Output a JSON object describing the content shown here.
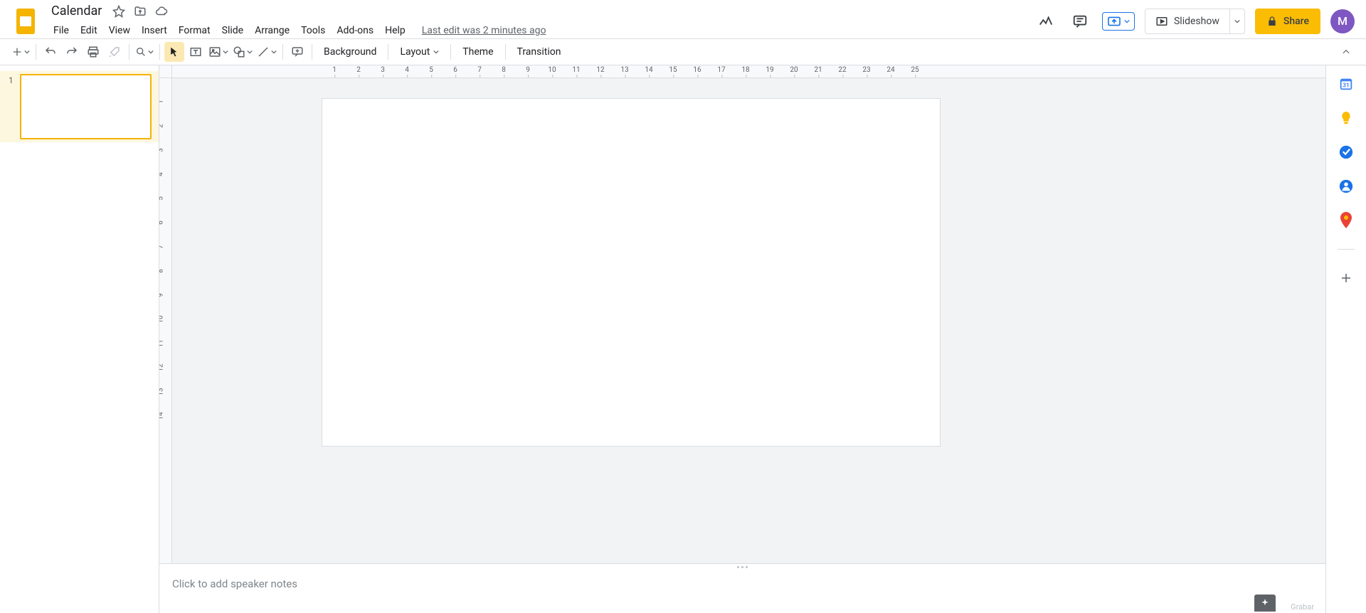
{
  "document": {
    "title": "Calendar",
    "last_edit": "Last edit was 2 minutes ago"
  },
  "menus": [
    "File",
    "Edit",
    "View",
    "Insert",
    "Format",
    "Slide",
    "Arrange",
    "Tools",
    "Add-ons",
    "Help"
  ],
  "header_buttons": {
    "slideshow": "Slideshow",
    "share": "Share"
  },
  "avatar": "M",
  "toolbar_text": {
    "background": "Background",
    "layout": "Layout",
    "theme": "Theme",
    "transition": "Transition"
  },
  "ruler_h": [
    "1",
    "2",
    "3",
    "4",
    "5",
    "6",
    "7",
    "8",
    "9",
    "10",
    "11",
    "12",
    "13",
    "14",
    "15",
    "16",
    "17",
    "18",
    "19",
    "20",
    "21",
    "22",
    "23",
    "24",
    "25"
  ],
  "ruler_v": [
    "1",
    "2",
    "3",
    "4",
    "5",
    "6",
    "7",
    "8",
    "9",
    "10",
    "11",
    "12",
    "13",
    "14"
  ],
  "slides": [
    {
      "number": "1"
    }
  ],
  "notes_placeholder": "Click to add speaker notes",
  "grabar": "Grabar"
}
